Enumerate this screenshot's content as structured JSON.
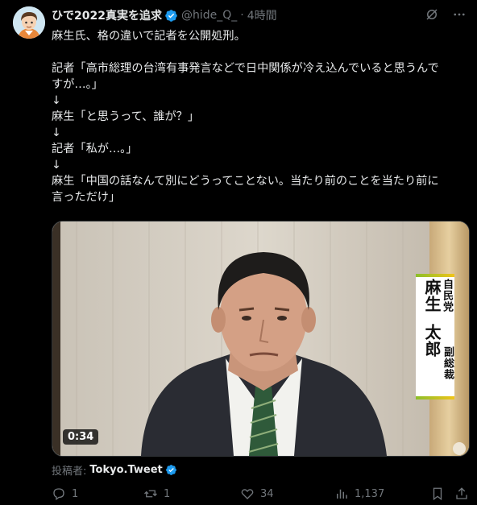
{
  "tweet": {
    "display_name": "ひで2022真実を追求",
    "handle": "@hide_Q_",
    "separator": "·",
    "time": "4時間",
    "body_lines": [
      "麻生氏、格の違いで記者を公開処刑。",
      "",
      "記者「高市総理の台湾有事発言などで日中関係が冷え込んでいると思うんで",
      "すが…。」",
      "↓",
      "麻生「と思うって、誰が？」",
      "↓",
      "記者「私が…。」",
      "↓",
      "麻生「中国の話なんて別にどうってことない。当たり前のことを当たり前に",
      "言っただけ」"
    ]
  },
  "media": {
    "duration": "0:34",
    "caption": {
      "party": "自民党",
      "name_family": "麻生",
      "name_given": "太郎",
      "role": "副総裁"
    }
  },
  "attribution": {
    "label": "投稿者:",
    "user": "Tokyo.Tweet"
  },
  "actions": {
    "reply_count": "1",
    "repost_count": "1",
    "like_count": "34",
    "view_count": "1,137"
  },
  "colors": {
    "background": "#000000",
    "text": "#e7e9ea",
    "secondary": "#71767b",
    "verified": "#1d9bf0"
  },
  "icons": [
    "grok-icon",
    "more-icon",
    "verified-badge-icon",
    "reply-icon",
    "repost-icon",
    "like-icon",
    "views-icon",
    "bookmark-icon",
    "share-icon"
  ]
}
